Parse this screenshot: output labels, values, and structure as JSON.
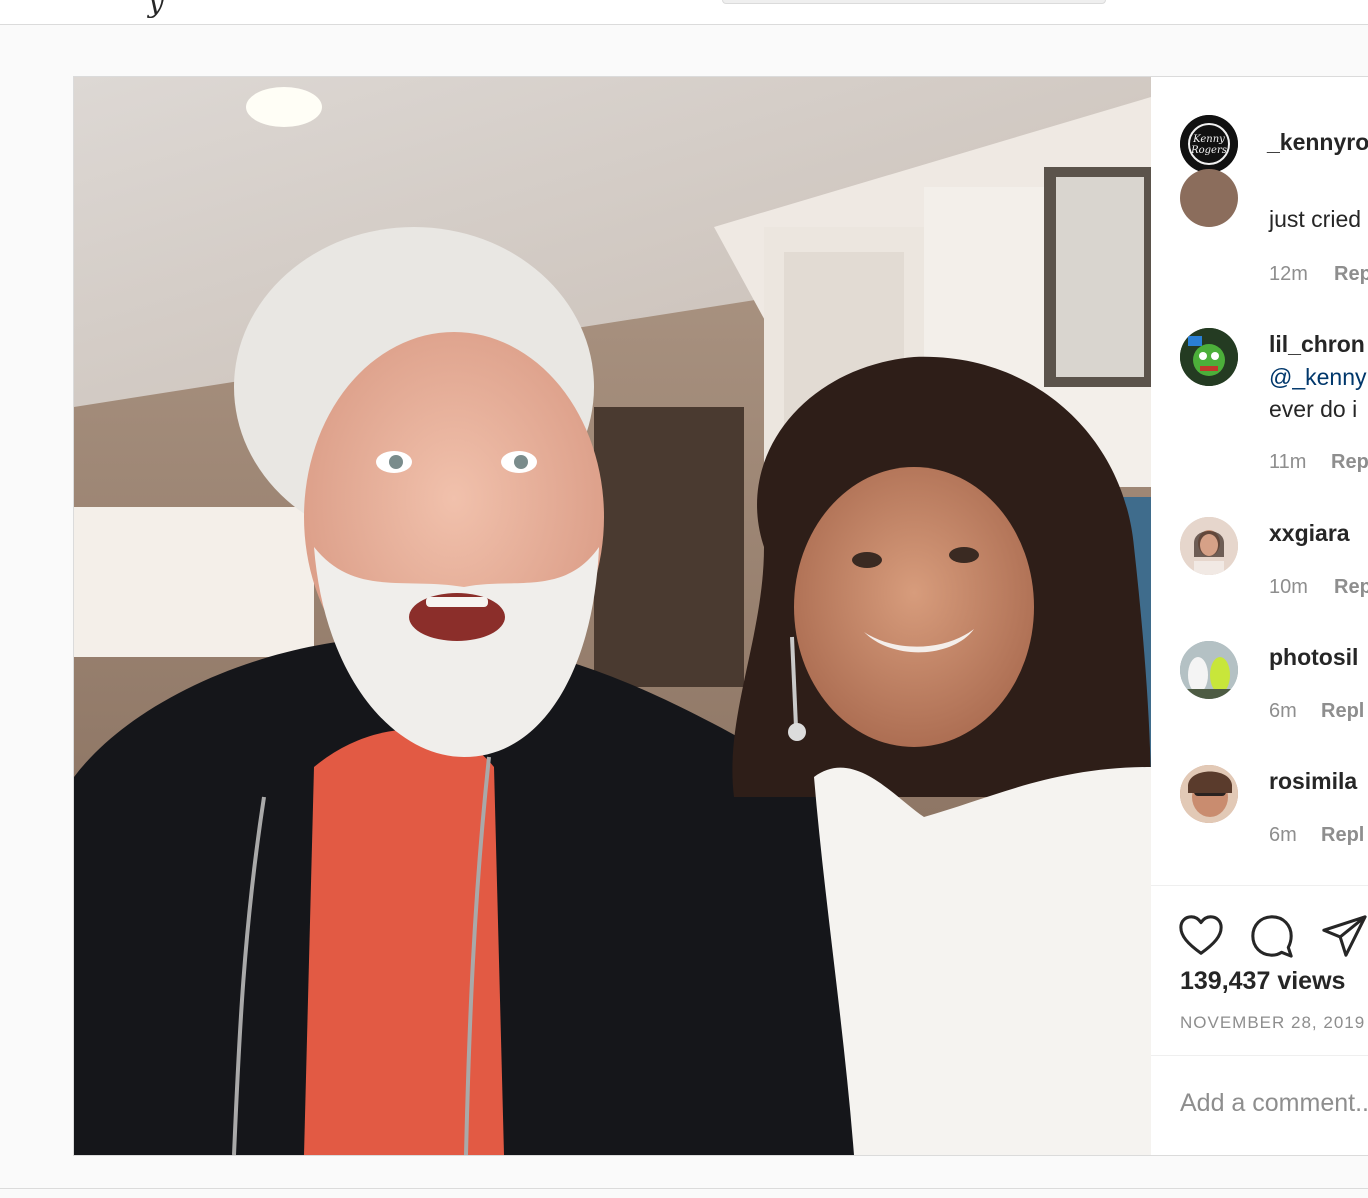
{
  "topbar": {
    "logo_fragment": "y"
  },
  "post": {
    "owner_username": "_kennyro",
    "owner_avatar_text": [
      "Kenny",
      "Rogers"
    ],
    "comments": [
      {
        "username": "",
        "text_lines": [
          "just cried"
        ],
        "time": "12m",
        "reply": "Rep"
      },
      {
        "username": "lil_chron",
        "text_lines": [
          "@_kenny",
          "ever do i"
        ],
        "time": "11m",
        "reply": "Rep"
      },
      {
        "username": "xxgiara",
        "text_lines": [],
        "time": "10m",
        "reply": "Rep"
      },
      {
        "username": "photosil",
        "text_lines": [],
        "time": "6m",
        "reply": "Repl"
      },
      {
        "username": "rosimila",
        "text_lines": [],
        "time": "6m",
        "reply": "Repl"
      }
    ],
    "actions": {
      "like_icon": "heart-icon",
      "comment_icon": "comment-bubble-icon",
      "share_icon": "paper-plane-icon"
    },
    "views": "139,437 views",
    "date": "NOVEMBER 28, 2019",
    "add_comment_placeholder": "Add a comment..."
  },
  "colors": {
    "text": "#262626",
    "muted": "#8e8e8e",
    "link": "#00376b",
    "border": "#dbdbdb",
    "bg": "#fafafa"
  }
}
